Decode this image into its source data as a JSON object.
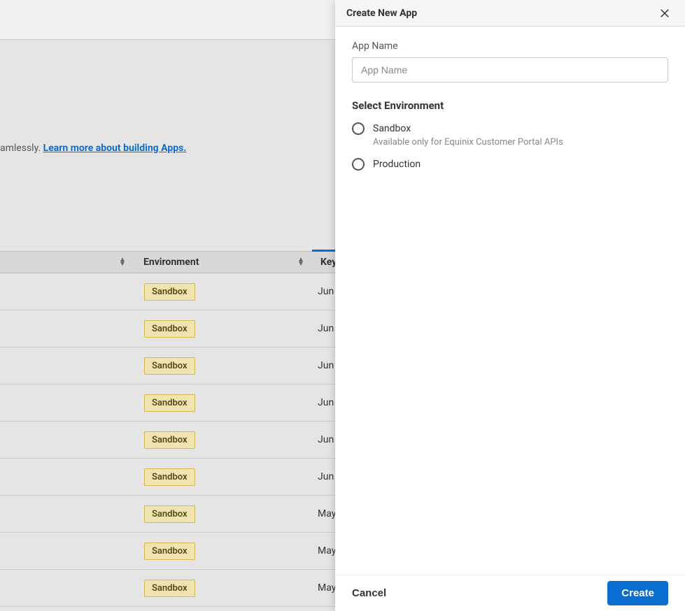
{
  "background": {
    "descSuffix": "amlessly. ",
    "learnMoreLink": "Learn more about building Apps.",
    "columns": {
      "environment": "Environment",
      "key": "Key"
    },
    "rows": [
      {
        "env": "Sandbox",
        "date": "Jun"
      },
      {
        "env": "Sandbox",
        "date": "Jun"
      },
      {
        "env": "Sandbox",
        "date": "Jun"
      },
      {
        "env": "Sandbox",
        "date": "Jun"
      },
      {
        "env": "Sandbox",
        "date": "Jun"
      },
      {
        "env": "Sandbox",
        "date": "Jun"
      },
      {
        "env": "Sandbox",
        "date": "May"
      },
      {
        "env": "Sandbox",
        "date": "May"
      },
      {
        "env": "Sandbox",
        "date": "May"
      }
    ]
  },
  "modal": {
    "title": "Create New App",
    "appNameLabel": "App Name",
    "appNamePlaceholder": "App Name",
    "selectEnvHeading": "Select Environment",
    "options": {
      "sandbox": {
        "label": "Sandbox",
        "helper": "Available only for Equinix Customer Portal APIs"
      },
      "production": {
        "label": "Production"
      }
    },
    "footer": {
      "cancel": "Cancel",
      "create": "Create"
    }
  }
}
